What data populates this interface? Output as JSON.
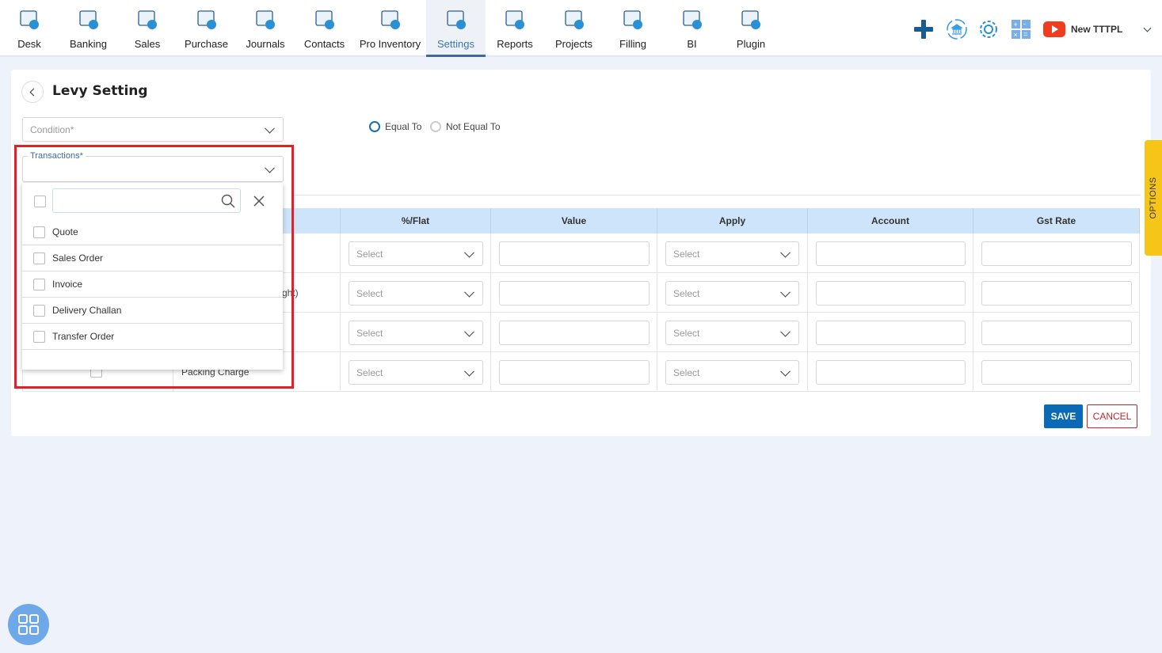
{
  "nav": {
    "items": [
      {
        "label": "Desk",
        "icon": "desk-icon"
      },
      {
        "label": "Banking",
        "icon": "bank-icon"
      },
      {
        "label": "Sales",
        "icon": "sales-icon"
      },
      {
        "label": "Purchase",
        "icon": "purchase-icon"
      },
      {
        "label": "Journals",
        "icon": "journals-icon"
      },
      {
        "label": "Contacts",
        "icon": "contacts-icon"
      },
      {
        "label": "Pro Inventory",
        "icon": "inventory-icon"
      },
      {
        "label": "Settings",
        "icon": "settings-icon",
        "active": true
      },
      {
        "label": "Reports",
        "icon": "reports-icon"
      },
      {
        "label": "Projects",
        "icon": "projects-icon"
      },
      {
        "label": "Filling",
        "icon": "filling-icon"
      },
      {
        "label": "BI",
        "icon": "bi-icon"
      },
      {
        "label": "Plugin",
        "icon": "plugin-icon"
      }
    ],
    "company": "New TTTPL"
  },
  "colors": {
    "accent": "#1c6bb0",
    "header_bg": "#cde4fb",
    "highlight": "#e3202a",
    "save": "#0b6ab5",
    "cancel": "#c0262d",
    "options_tab": "#f5c518"
  },
  "page": {
    "title": "Levy Setting",
    "condition_placeholder": "Condition*",
    "radios": [
      {
        "label": "Equal To",
        "selected": true
      },
      {
        "label": "Not Equal To",
        "selected": false
      }
    ],
    "transactions_label": "Transactions*",
    "transactions_options": [
      "Quote",
      "Sales Order",
      "Invoice",
      "Delivery Challan",
      "Transfer Order"
    ],
    "table": {
      "headers": [
        "%/Flat",
        "Value",
        "Apply",
        "Account",
        "Gst Rate"
      ],
      "rows": [
        {
          "name": ""
        },
        {
          "name": "ght)"
        },
        {
          "name": ""
        },
        {
          "name": "Packing Charge"
        }
      ],
      "select_placeholder": "Select"
    },
    "save": "SAVE",
    "cancel": "CANCEL",
    "options_tab": "OPTIONS"
  }
}
